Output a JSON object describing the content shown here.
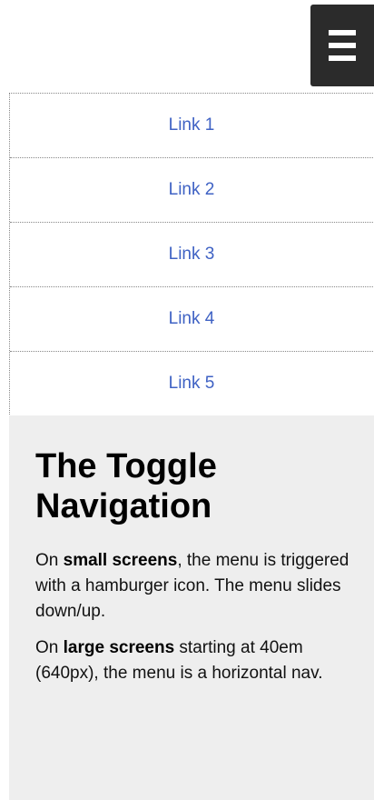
{
  "nav": {
    "toggle_icon": "hamburger-icon",
    "links": [
      {
        "label": "Link 1"
      },
      {
        "label": "Link 2"
      },
      {
        "label": "Link 3"
      },
      {
        "label": "Link 4"
      },
      {
        "label": "Link 5"
      }
    ]
  },
  "main": {
    "title_line1": "The Toggle",
    "title_line2": "Navigation",
    "paragraph1": {
      "prefix": "On ",
      "emphasis": "small screens",
      "suffix": ", the menu is triggered with a hamburger icon. The menu slides down/up."
    },
    "paragraph2": {
      "prefix": "On ",
      "emphasis": "large screens",
      "suffix": " starting at 40em (640px), the menu is a horizontal nav."
    }
  },
  "colors": {
    "toggle_bg": "#2b2b2b",
    "link": "#3f62c4",
    "content_bg": "#eeeeee"
  }
}
